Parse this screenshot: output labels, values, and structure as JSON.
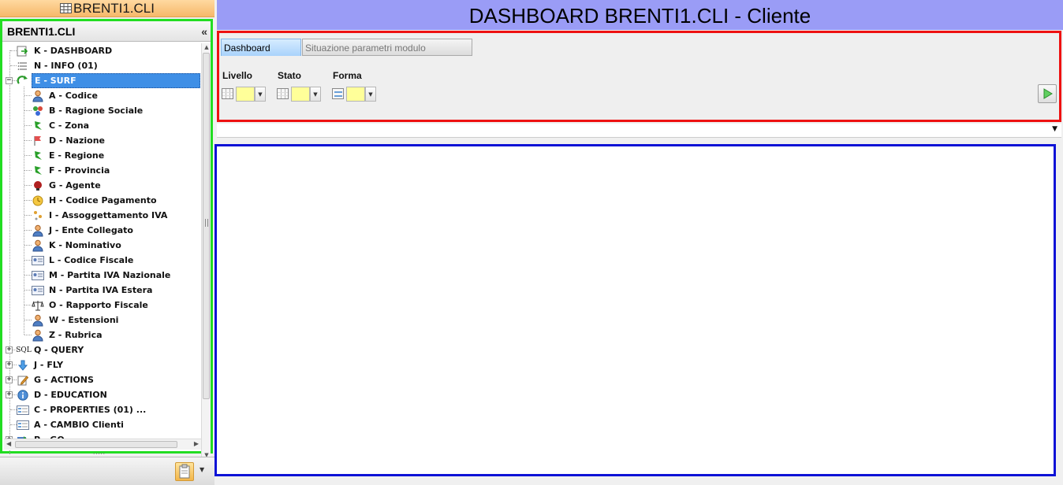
{
  "app": {
    "title": "BRENTI1.CLI"
  },
  "tree": {
    "header": "BRENTI1.CLI",
    "collapse_glyph": "«",
    "items": [
      {
        "label": "K - DASHBOARD",
        "icon": "dashboard-arrow-icon",
        "level": 0
      },
      {
        "label": "N - INFO (01)",
        "icon": "info-list-icon",
        "level": 0
      },
      {
        "label": "E - SURF",
        "icon": "surf-refresh-icon",
        "level": 0,
        "expanded": true,
        "selected": true
      },
      {
        "label": "A - Codice",
        "icon": "person-icon",
        "level": 1
      },
      {
        "label": "B - Ragione Sociale",
        "icon": "people-group-icon",
        "level": 1
      },
      {
        "label": "C - Zona",
        "icon": "map-zone-icon",
        "level": 1
      },
      {
        "label": "D - Nazione",
        "icon": "flag-icon",
        "level": 1
      },
      {
        "label": "E - Regione",
        "icon": "map-region-icon",
        "level": 1
      },
      {
        "label": "F - Provincia",
        "icon": "map-province-icon",
        "level": 1
      },
      {
        "label": "G - Agente",
        "icon": "agent-icon",
        "level": 1
      },
      {
        "label": "H - Codice Pagamento",
        "icon": "coin-icon",
        "level": 1
      },
      {
        "label": "I - Assoggettamento IVA",
        "icon": "tax-icon",
        "level": 1
      },
      {
        "label": "J - Ente Collegato",
        "icon": "person-icon",
        "level": 1
      },
      {
        "label": "K - Nominativo",
        "icon": "person-icon",
        "level": 1
      },
      {
        "label": "L - Codice Fiscale",
        "icon": "id-card-icon",
        "level": 1
      },
      {
        "label": "M - Partita IVA Nazionale",
        "icon": "id-card-icon",
        "level": 1
      },
      {
        "label": "N - Partita IVA Estera",
        "icon": "id-card-icon",
        "level": 1
      },
      {
        "label": "O - Rapporto Fiscale",
        "icon": "balance-scale-icon",
        "level": 1
      },
      {
        "label": "W - Estensioni",
        "icon": "person-icon",
        "level": 1
      },
      {
        "label": "Z - Rubrica",
        "icon": "person-icon",
        "level": 1
      },
      {
        "label": "Q - QUERY",
        "icon": "sql-icon",
        "icon_text": "SQL",
        "level": 0,
        "expandable": true
      },
      {
        "label": "J - FLY",
        "icon": "down-arrow-icon",
        "level": 0,
        "expandable": true
      },
      {
        "label": "G - ACTIONS",
        "icon": "pencil-note-icon",
        "level": 0,
        "expandable": true
      },
      {
        "label": "D - EDUCATION",
        "icon": "info-circle-icon",
        "level": 0,
        "expandable": true
      },
      {
        "label": "C - PROPERTIES (01) ...",
        "icon": "properties-form-icon",
        "level": 0
      },
      {
        "label": "A - CAMBIO Clienti",
        "icon": "properties-form-icon",
        "level": 0
      },
      {
        "label": "P - GO",
        "icon": "go-icon",
        "level": 0,
        "expandable": true
      }
    ]
  },
  "main": {
    "title": "DASHBOARD BRENTI1.CLI - Cliente",
    "tabs": [
      {
        "label": "Dashboard",
        "active": true
      },
      {
        "label": "Situazione parametri modulo",
        "active": false
      }
    ],
    "filters": [
      {
        "label": "Livello",
        "icon": "grid-table-icon"
      },
      {
        "label": "Stato",
        "icon": "grid-table-icon"
      },
      {
        "label": "Forma",
        "icon": "form-layout-icon"
      }
    ],
    "run_button_icon": "play-icon"
  },
  "colors": {
    "tree_border": "#22dd22",
    "filter_border": "#ee1111",
    "content_border": "#0d12d6",
    "title_bar": "#9a9cf6",
    "selected_row": "#3f8fe6",
    "combo_field": "#ffff99"
  }
}
